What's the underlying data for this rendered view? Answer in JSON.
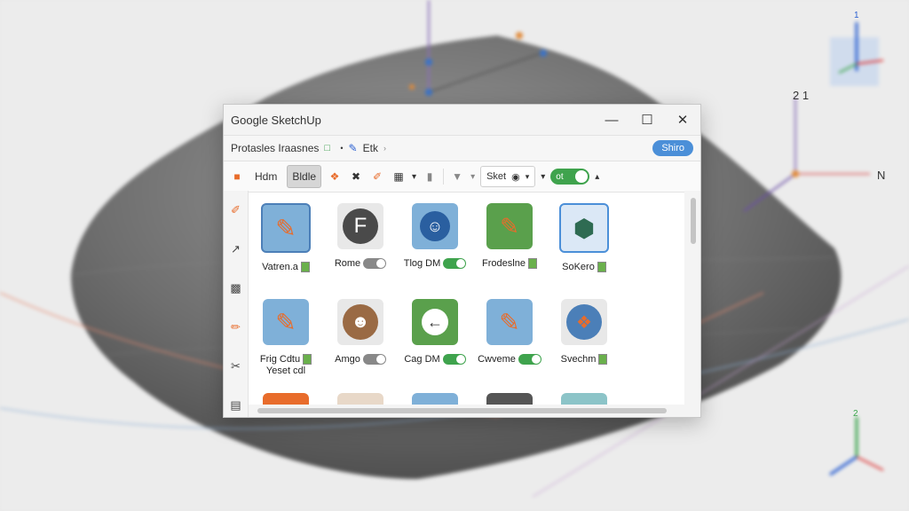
{
  "window": {
    "title": "Google SketchUp"
  },
  "menubar": {
    "item1": "Protasles Iraasnes",
    "item2": "Etk",
    "share": "Shiro"
  },
  "toolbar": {
    "item1": "Hdm",
    "item2": "Bldle",
    "select_label": "Sket",
    "toggle_label": "ot"
  },
  "scene_labels": {
    "axis_a": "2 1",
    "axis_b": "N",
    "axis_c": "N",
    "axis_top": "1",
    "axis_bottom": "2"
  },
  "extensions": [
    {
      "label": "Vatren.a"
    },
    {
      "label": "Rome"
    },
    {
      "label": "Tlog DM"
    },
    {
      "label": "Frodeslne"
    },
    {
      "label": "SoKero"
    },
    {
      "label": "Frig Cdtu",
      "sublabel": "Yeset cdl"
    },
    {
      "label": "Amgo"
    },
    {
      "label": "Cag DM"
    },
    {
      "label": "Cwveme"
    },
    {
      "label": "Svechm"
    }
  ],
  "colors": {
    "accent": "#4b8fd8",
    "toggle_on": "#3fa34d",
    "icon_orange": "#e86c2b",
    "icon_blue": "#5b9bd5"
  }
}
